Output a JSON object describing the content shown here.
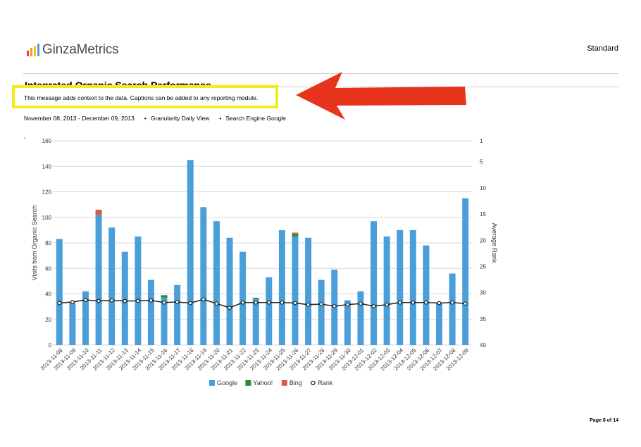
{
  "header": {
    "logo_text": "GinzaMetrics",
    "logo_bar_colors": [
      "#e7452c",
      "#f39a1e",
      "#f5c51c",
      "#4c9fd8"
    ],
    "report_type": "Standard"
  },
  "section": {
    "title": "Integrated Organic Search Performance",
    "caption": "This message adds context to the data. Captions can be added to any reporting module.",
    "highlight_color": "#f3ec1a",
    "arrow_color": "#e8341c"
  },
  "filters": {
    "date_range": "November 08, 2013 - December 09, 2013",
    "granularity": "Granularity Daily View",
    "search_engine": "Search Engine Google"
  },
  "chart_data": {
    "type": "bar",
    "stacked": true,
    "categories": [
      "2013-11-08",
      "2013-11-09",
      "2013-11-10",
      "2013-11-11",
      "2013-11-12",
      "2013-11-13",
      "2013-11-14",
      "2013-11-15",
      "2013-11-16",
      "2013-11-17",
      "2013-11-18",
      "2013-11-19",
      "2013-11-20",
      "2013-11-21",
      "2013-11-22",
      "2013-11-23",
      "2013-11-24",
      "2013-11-25",
      "2013-11-26",
      "2013-11-27",
      "2013-11-28",
      "2013-11-29",
      "2013-11-30",
      "2013-12-01",
      "2013-12-02",
      "2013-12-03",
      "2013-12-04",
      "2013-12-05",
      "2013-12-06",
      "2013-12-07",
      "2013-12-08",
      "2013-12-09"
    ],
    "series": [
      {
        "name": "Google",
        "color": "#4a9fd8",
        "values": [
          83,
          33,
          42,
          102,
          92,
          73,
          85,
          51,
          37,
          47,
          145,
          108,
          97,
          84,
          73,
          36,
          53,
          90,
          85,
          84,
          51,
          59,
          35,
          42,
          97,
          85,
          90,
          90,
          78,
          33,
          56,
          115
        ]
      },
      {
        "name": "Yahoo!",
        "color": "#2f8a3c",
        "values": [
          0,
          0,
          0,
          0,
          0,
          0,
          0,
          0,
          2,
          0,
          0,
          0,
          0,
          0,
          0,
          1,
          0,
          0,
          2,
          0,
          0,
          0,
          0,
          0,
          0,
          0,
          0,
          0,
          0,
          0,
          0,
          0
        ]
      },
      {
        "name": "Bing",
        "color": "#e0554a",
        "values": [
          0,
          0,
          0,
          4,
          0,
          0,
          0,
          0,
          0,
          0,
          0,
          0,
          0,
          0,
          0,
          0,
          0,
          0,
          1,
          0,
          0,
          0,
          0,
          0,
          0,
          0,
          0,
          0,
          0,
          0,
          0,
          0
        ]
      }
    ],
    "rank": {
      "name": "Rank",
      "values": [
        32,
        31.8,
        31.4,
        31.6,
        31.5,
        31.6,
        31.6,
        31.5,
        31.9,
        31.8,
        32,
        31.3,
        32.1,
        32.9,
        31.9,
        31.9,
        31.9,
        31.9,
        32,
        32.3,
        32.2,
        32.6,
        32.3,
        32.1,
        32.6,
        32.3,
        31.9,
        31.9,
        31.9,
        32,
        31.9,
        32.1
      ]
    },
    "ylabel": "Visits from Organic Search",
    "y2label": "Average Rank",
    "ylim": [
      0,
      160
    ],
    "yticks": [
      "0",
      "20",
      "40",
      "60",
      "80",
      "100",
      "120",
      "140",
      "160"
    ],
    "y2lim": [
      1,
      40
    ],
    "y2ticks": [
      "1",
      "5",
      "10",
      "15",
      "20",
      "25",
      "30",
      "35",
      "40"
    ],
    "grid": true,
    "legend_position": "bottom"
  },
  "footer": {
    "page_label": "Page 8 of 14"
  }
}
